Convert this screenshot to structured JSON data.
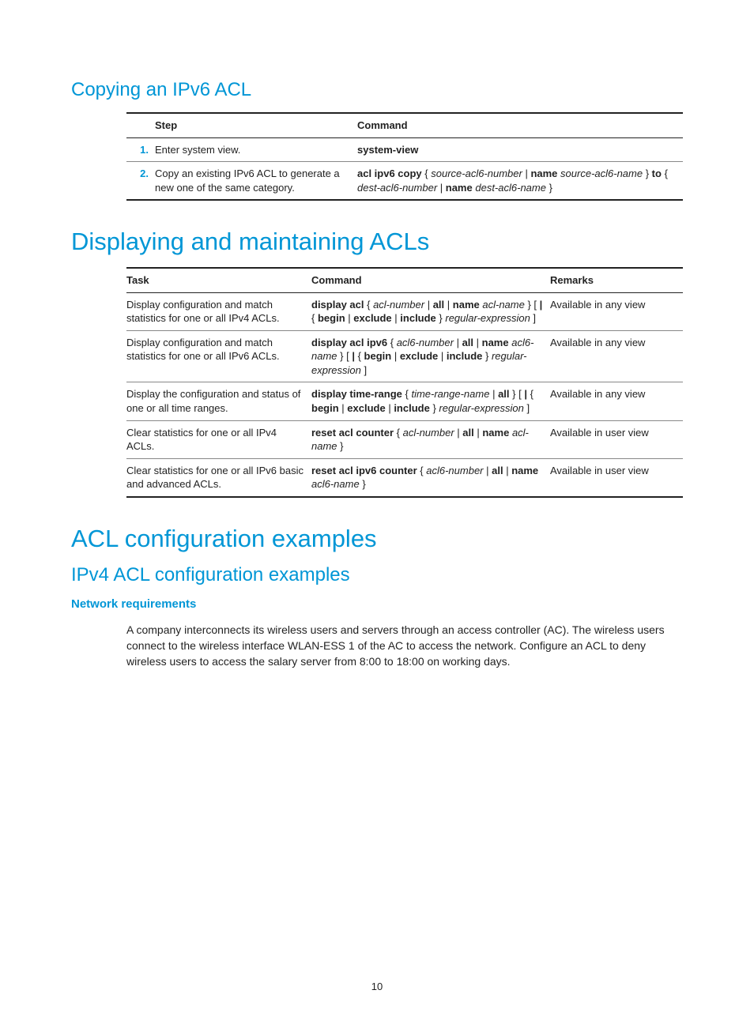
{
  "copying": {
    "title": "Copying an IPv6 ACL",
    "headers": {
      "step": "Step",
      "command": "Command"
    },
    "rows": [
      {
        "num": "1.",
        "step": "Enter system view.",
        "command": [
          {
            "t": "system-view",
            "b": true
          }
        ]
      },
      {
        "num": "2.",
        "step": "Copy an existing IPv6 ACL to generate a new one of the same category.",
        "command": [
          {
            "t": "acl ipv6 copy",
            "b": true
          },
          {
            "t": " { "
          },
          {
            "t": "source-acl6-number",
            "i": true
          },
          {
            "t": " | "
          },
          {
            "t": "name",
            "b": true
          },
          {
            "t": " "
          },
          {
            "t": "source-acl6-name",
            "i": true
          },
          {
            "t": " } "
          },
          {
            "t": "to",
            "b": true
          },
          {
            "t": " { "
          },
          {
            "t": "dest-acl6-number",
            "i": true
          },
          {
            "t": " | "
          },
          {
            "t": "name",
            "b": true
          },
          {
            "t": " "
          },
          {
            "t": "dest-acl6-name",
            "i": true
          },
          {
            "t": " }"
          }
        ]
      }
    ]
  },
  "displaying": {
    "title": "Displaying and maintaining ACLs",
    "headers": {
      "task": "Task",
      "command": "Command",
      "remarks": "Remarks"
    },
    "rows": [
      {
        "task": "Display configuration and match statistics for one or all IPv4 ACLs.",
        "command": [
          {
            "t": "display acl",
            "b": true
          },
          {
            "t": " { "
          },
          {
            "t": "acl-number",
            "i": true
          },
          {
            "t": " | "
          },
          {
            "t": "all",
            "b": true
          },
          {
            "t": " | "
          },
          {
            "t": "name",
            "b": true
          },
          {
            "t": " "
          },
          {
            "t": "acl-name",
            "i": true
          },
          {
            "t": " } [ "
          },
          {
            "t": "|",
            "b": true
          },
          {
            "t": " { "
          },
          {
            "t": "begin",
            "b": true
          },
          {
            "t": " | "
          },
          {
            "t": "exclude",
            "b": true
          },
          {
            "t": " | "
          },
          {
            "t": "include",
            "b": true
          },
          {
            "t": " } "
          },
          {
            "t": "regular-expression",
            "i": true
          },
          {
            "t": " ]"
          }
        ],
        "remarks": "Available in any view"
      },
      {
        "task": "Display configuration and match statistics for one or all IPv6 ACLs.",
        "command": [
          {
            "t": "display acl ipv6",
            "b": true
          },
          {
            "t": " { "
          },
          {
            "t": "acl6-number",
            "i": true
          },
          {
            "t": " | "
          },
          {
            "t": "all",
            "b": true
          },
          {
            "t": " | "
          },
          {
            "t": "name",
            "b": true
          },
          {
            "t": " "
          },
          {
            "t": "acl6-name",
            "i": true
          },
          {
            "t": " } [ "
          },
          {
            "t": "|",
            "b": true
          },
          {
            "t": " { "
          },
          {
            "t": "begin",
            "b": true
          },
          {
            "t": " | "
          },
          {
            "t": "exclude",
            "b": true
          },
          {
            "t": " | "
          },
          {
            "t": "include",
            "b": true
          },
          {
            "t": " } "
          },
          {
            "t": "regular-expression",
            "i": true
          },
          {
            "t": " ]"
          }
        ],
        "remarks": "Available in any view"
      },
      {
        "task": "Display the configuration and status of one or all time ranges.",
        "command": [
          {
            "t": "display time-range",
            "b": true
          },
          {
            "t": " { "
          },
          {
            "t": "time-range-name",
            "i": true
          },
          {
            "t": " | "
          },
          {
            "t": "all",
            "b": true
          },
          {
            "t": " } [ "
          },
          {
            "t": "|",
            "b": true
          },
          {
            "t": " { "
          },
          {
            "t": "begin",
            "b": true
          },
          {
            "t": " | "
          },
          {
            "t": "exclude",
            "b": true
          },
          {
            "t": " | "
          },
          {
            "t": "include",
            "b": true
          },
          {
            "t": " } "
          },
          {
            "t": "regular-expression",
            "i": true
          },
          {
            "t": " ]"
          }
        ],
        "remarks": "Available in any view"
      },
      {
        "task": "Clear statistics for one or all IPv4 ACLs.",
        "command": [
          {
            "t": "reset acl counter",
            "b": true
          },
          {
            "t": " { "
          },
          {
            "t": "acl-number",
            "i": true
          },
          {
            "t": " | "
          },
          {
            "t": "all",
            "b": true
          },
          {
            "t": " | "
          },
          {
            "t": "name",
            "b": true
          },
          {
            "t": " "
          },
          {
            "t": "acl-name",
            "i": true
          },
          {
            "t": " }"
          }
        ],
        "remarks": "Available in user view"
      },
      {
        "task": "Clear statistics for one or all IPv6 basic and advanced ACLs.",
        "command": [
          {
            "t": "reset acl ipv6 counter",
            "b": true
          },
          {
            "t": " { "
          },
          {
            "t": "acl6-number",
            "i": true
          },
          {
            "t": " | "
          },
          {
            "t": "all",
            "b": true
          },
          {
            "t": " | "
          },
          {
            "t": "name",
            "b": true
          },
          {
            "t": " "
          },
          {
            "t": "acl6-name",
            "i": true
          },
          {
            "t": " }"
          }
        ],
        "remarks": "Available in user view"
      }
    ]
  },
  "examples": {
    "title": "ACL configuration examples",
    "ipv4_title": "IPv4 ACL configuration examples",
    "netreq_title": "Network requirements",
    "netreq_body": "A company interconnects its wireless users and servers through an access controller (AC). The wireless users connect to the wireless interface WLAN-ESS 1 of the AC to access the network. Configure an ACL to deny wireless users to access the salary server from 8:00 to 18:00 on working days."
  },
  "page_number": "10"
}
